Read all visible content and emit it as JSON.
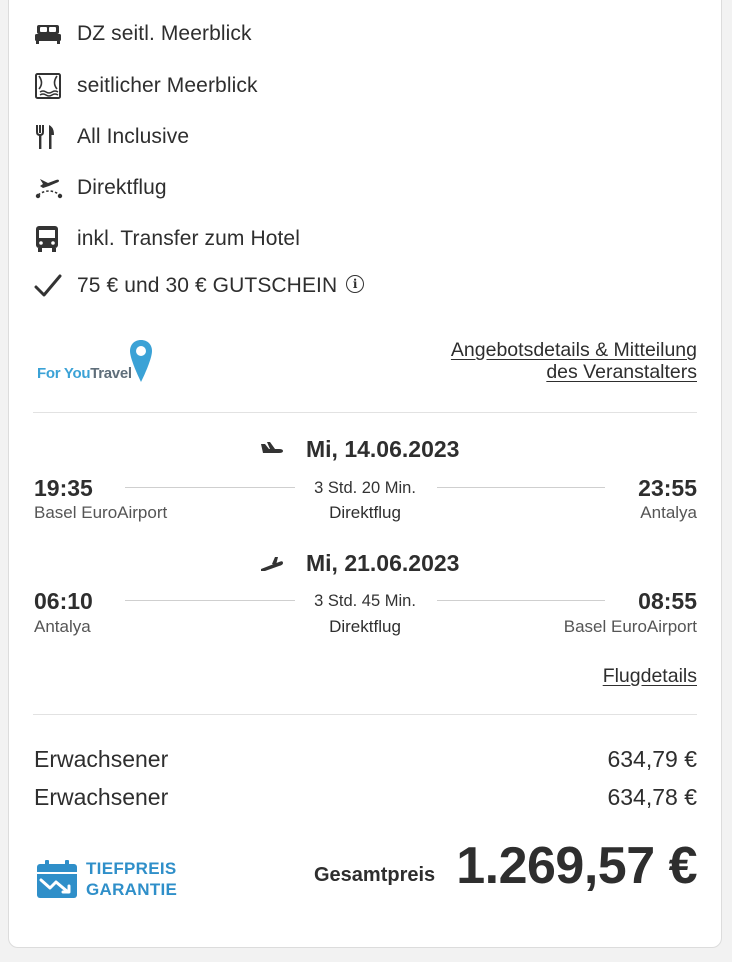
{
  "features": [
    {
      "icon": "bed-icon",
      "text": "DZ seitl. Meerblick"
    },
    {
      "icon": "sea-view-icon",
      "text": "seitlicher Meerblick"
    },
    {
      "icon": "cutlery-icon",
      "text": "All Inclusive"
    },
    {
      "icon": "flight-route-icon",
      "text": "Direktflug"
    },
    {
      "icon": "bus-icon",
      "text": "inkl. Transfer zum Hotel"
    },
    {
      "icon": "checkmark-icon",
      "text": "75 € und 30 € GUTSCHEIN"
    }
  ],
  "operator": {
    "logo_part1": "For You",
    "logo_part2": "Travel",
    "details_link_line1": "Angebotsdetails & Mitteilung",
    "details_link_line2": "des Veranstalters"
  },
  "flights": {
    "outbound": {
      "date": "Mi, 14.06.2023",
      "depart_time": "19:35",
      "depart_place": "Basel EuroAirport",
      "duration": "3 Std. 20 Min.",
      "type": "Direktflug",
      "arrive_time": "23:55",
      "arrive_place": "Antalya"
    },
    "return": {
      "date": "Mi, 21.06.2023",
      "depart_time": "06:10",
      "depart_place": "Antalya",
      "duration": "3 Std. 45 Min.",
      "type": "Direktflug",
      "arrive_time": "08:55",
      "arrive_place": "Basel EuroAirport"
    },
    "details_link": "Flugdetails"
  },
  "prices": {
    "rows": [
      {
        "label": "Erwachsener",
        "value": "634,79 €"
      },
      {
        "label": "Erwachsener",
        "value": "634,78 €"
      }
    ],
    "badge_line1": "TIEFPREIS",
    "badge_line2": "GARANTIE",
    "total_label": "Gesamtpreis",
    "total_value": "1.269,57 €"
  },
  "colors": {
    "accent": "#2f8fc9",
    "text": "#2e2e2e"
  }
}
